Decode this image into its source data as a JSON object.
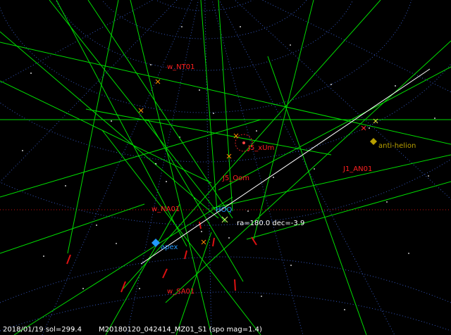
{
  "labels": {
    "w_nt01": "w_NT01",
    "j5_xum": "J5_xUm",
    "j5_oom": "J5_Oom",
    "j1_an01": "J1_AN01",
    "anti_helion": "anti-helion",
    "w_na01": "w_NA01",
    "hoq": "HOQ",
    "apex": "apex",
    "w_sa01": "w_SA01",
    "radiant_coords": "ra=180.0 dec=-3.9"
  },
  "status": {
    "date_sol": "2018/01/19 sol=299.4",
    "file_info": "M20180120_042414_MZ01_S1 (spo mag=1.4)"
  },
  "colors": {
    "meteor_trail": "#00dd00",
    "radiant_label": "#ff2020",
    "grid": "#3355bb",
    "ecliptic": "#cc1111",
    "apex": "#2299ff",
    "anti_helion": "#b8a000",
    "target_line": "#ffffff"
  }
}
